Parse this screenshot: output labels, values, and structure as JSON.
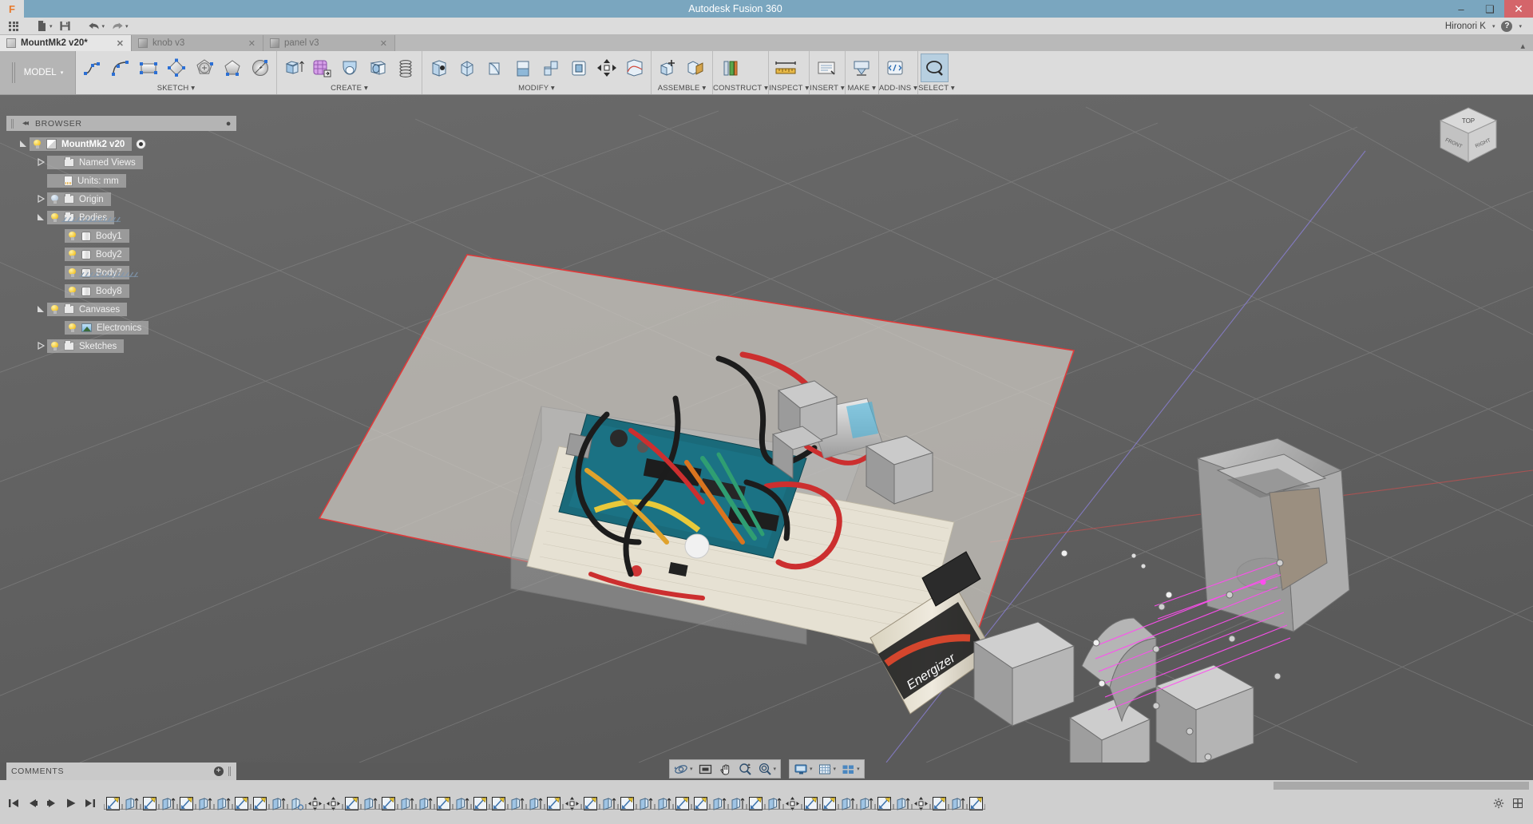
{
  "window": {
    "title": "Autodesk Fusion 360",
    "brand_letter": "F",
    "minimize": "–",
    "maximize": "❑",
    "close": "✕"
  },
  "quick_access": {
    "apps_icon": "grid-apps-icon",
    "new_icon": "new-document-icon",
    "save_icon": "save-icon",
    "undo_icon": "undo-icon",
    "redo_icon": "redo-icon",
    "caret": "▾",
    "user_name": "Hironori K",
    "help_icon": "help-icon",
    "collapse_icon": "▴"
  },
  "document_tabs": [
    {
      "label": "MountMk2 v20*",
      "active": true,
      "close": "✕"
    },
    {
      "label": "knob v3",
      "active": false,
      "close": "✕"
    },
    {
      "label": "panel v3",
      "active": false,
      "close": "✕"
    }
  ],
  "workspace": {
    "label": "MODEL",
    "caret": "▾"
  },
  "ribbon_groups": [
    {
      "label": "SKETCH ▾",
      "icons": [
        "line-icon",
        "spline-icon",
        "rectangle-icon",
        "polygon-icon",
        "circle-polygon-icon",
        "pentagon-icon",
        "ellipse-icon"
      ]
    },
    {
      "label": "CREATE ▾",
      "icons": [
        "extrude-icon",
        "pattern-icon",
        "revolve-icon",
        "loft-icon",
        "coil-icon"
      ]
    },
    {
      "label": "MODIFY ▾",
      "icons": [
        "press-pull-icon",
        "fillet-icon",
        "shell-icon",
        "draft-icon",
        "combine-icon",
        "split-icon",
        "move-copy-icon",
        "align-icon"
      ]
    },
    {
      "label": "ASSEMBLE ▾",
      "icons": [
        "new-component-icon",
        "joint-icon"
      ]
    },
    {
      "label": "CONSTRUCT ▾",
      "icons": [
        "offset-plane-icon"
      ]
    },
    {
      "label": "INSPECT ▾",
      "icons": [
        "measure-icon"
      ]
    },
    {
      "label": "INSERT ▾",
      "icons": [
        "insert-mcmaster-icon"
      ]
    },
    {
      "label": "MAKE ▾",
      "icons": [
        "3d-print-icon"
      ]
    },
    {
      "label": "ADD-INS ▾",
      "icons": [
        "scripts-addins-icon"
      ]
    },
    {
      "label": "SELECT ▾",
      "icons": [
        "select-icon"
      ],
      "selected": true
    }
  ],
  "browser": {
    "title": "BROWSER",
    "collapse_icon": "◂◂",
    "pin_icon": "●",
    "tree": [
      {
        "label": "MountMk2 v20",
        "indent": 0,
        "expander": "expanded",
        "bulb": "on",
        "icon": "component-icon",
        "root": true,
        "radio": true
      },
      {
        "label": "Named Views",
        "indent": 1,
        "expander": "collapsed",
        "bulb": "none",
        "icon": "folder-icon"
      },
      {
        "label": "Units: mm",
        "indent": 1,
        "expander": "none",
        "bulb": "none",
        "icon": "units-icon"
      },
      {
        "label": "Origin",
        "indent": 1,
        "expander": "collapsed",
        "bulb": "off",
        "icon": "folder-icon"
      },
      {
        "label": "Bodies",
        "indent": 1,
        "expander": "expanded",
        "bulb": "on",
        "icon": "folder-icon",
        "hatched": true
      },
      {
        "label": "Body1",
        "indent": 2,
        "expander": "none",
        "bulb": "on",
        "icon": "body-icon"
      },
      {
        "label": "Body2",
        "indent": 2,
        "expander": "none",
        "bulb": "on",
        "icon": "body-icon"
      },
      {
        "label": "Body7",
        "indent": 2,
        "expander": "none",
        "bulb": "on",
        "icon": "body-icon",
        "hatched": true
      },
      {
        "label": "Body8",
        "indent": 2,
        "expander": "none",
        "bulb": "on",
        "icon": "body-icon"
      },
      {
        "label": "Canvases",
        "indent": 1,
        "expander": "expanded",
        "bulb": "on",
        "icon": "folder-icon"
      },
      {
        "label": "Electronics",
        "indent": 2,
        "expander": "none",
        "bulb": "on",
        "icon": "canvas-image-icon"
      },
      {
        "label": "Sketches",
        "indent": 1,
        "expander": "collapsed",
        "bulb": "on",
        "icon": "folder-icon"
      }
    ]
  },
  "comments": {
    "title": "COMMENTS",
    "add_icon": "+"
  },
  "navbar": {
    "groups": [
      {
        "buttons": [
          {
            "name": "orbit-icon",
            "caret": "▾"
          },
          {
            "name": "look-at-icon",
            "caret": ""
          },
          {
            "name": "pan-icon",
            "caret": ""
          },
          {
            "name": "zoom-icon",
            "caret": ""
          },
          {
            "name": "fit-icon",
            "caret": "▾"
          }
        ]
      },
      {
        "buttons": [
          {
            "name": "display-settings-icon",
            "caret": "▾"
          },
          {
            "name": "grid-snaps-icon",
            "caret": "▾"
          },
          {
            "name": "viewports-icon",
            "caret": "▾"
          }
        ]
      }
    ]
  },
  "timeline": {
    "playback": [
      "go-to-start-icon",
      "step-back-icon",
      "step-forward-icon",
      "play-icon",
      "go-to-end-icon"
    ],
    "features": [
      "sketch-icon",
      "extrude-icon",
      "sketch-icon",
      "extrude-icon",
      "sketch-icon",
      "extrude-icon",
      "extrude-icon",
      "sketch-icon",
      "sketch-icon",
      "extrude-icon",
      "fillet-icon",
      "move-icon",
      "move-icon",
      "sketch-icon",
      "extrude-icon",
      "sketch-icon",
      "extrude-icon",
      "extrude-icon",
      "sketch-icon",
      "extrude-icon",
      "sketch-icon",
      "sketch-icon",
      "extrude-icon",
      "extrude-icon",
      "sketch-icon",
      "move-icon",
      "sketch-icon",
      "extrude-icon",
      "sketch-icon",
      "extrude-icon",
      "extrude-icon",
      "sketch-icon",
      "sketch-icon",
      "extrude-icon",
      "extrude-icon",
      "sketch-icon",
      "extrude-icon",
      "move-icon",
      "sketch-icon",
      "sketch-icon",
      "extrude-icon",
      "extrude-icon",
      "sketch-icon",
      "extrude-icon",
      "move-icon",
      "sketch-icon",
      "extrude-icon",
      "sketch-icon"
    ],
    "end_controls": [
      "timeline-settings-icon",
      "timeline-expand-icon"
    ]
  },
  "viewcube": {
    "top_label": "TOP",
    "front_label": "FRONT",
    "right_label": "RIGHT"
  },
  "colors": {
    "title_bar": "#7aa6bf",
    "close_button": "#d4656a",
    "chrome": "#dcdcdc",
    "canvas_bg": "#636363",
    "sketch_plane_edge": "#e03a3a",
    "highlight_magenta": "#ff4df0",
    "selection_blue": "#b7cfe0"
  }
}
